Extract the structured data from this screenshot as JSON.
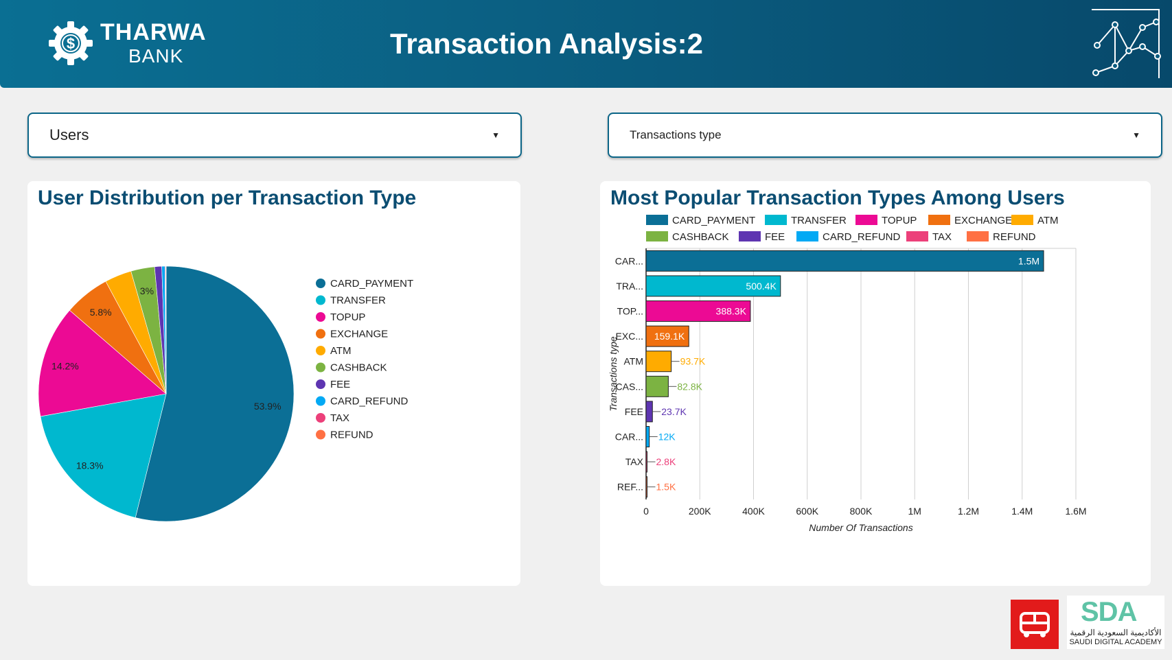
{
  "header": {
    "brand_name": "THARWA",
    "brand_sub": "BANK",
    "title": "Transaction Analysis:2"
  },
  "filters": {
    "users_label": "Users",
    "type_label": "Transactions type"
  },
  "colors": {
    "CARD_PAYMENT": "#0b6f96",
    "TRANSFER": "#00b8cf",
    "TOPUP": "#ec0a94",
    "EXCHANGE": "#f07010",
    "ATM": "#ffab00",
    "CASHBACK": "#7cb342",
    "FEE": "#5e35b1",
    "CARD_REFUND": "#03a9f4",
    "TAX": "#ec407a",
    "REFUND": "#ff7043"
  },
  "pie_chart": {
    "title": "User Distribution per Transaction Type"
  },
  "bar_chart": {
    "title": "Most Popular Transaction Types Among Users"
  },
  "chart_data": [
    {
      "type": "pie",
      "title": "User Distribution per Transaction Type",
      "categories": [
        "CARD_PAYMENT",
        "TRANSFER",
        "TOPUP",
        "EXCHANGE",
        "ATM",
        "CASHBACK",
        "FEE",
        "CARD_REFUND",
        "TAX",
        "REFUND"
      ],
      "values": [
        53.9,
        18.3,
        14.2,
        5.8,
        3.4,
        3.0,
        0.9,
        0.4,
        0.1,
        0.05
      ],
      "value_labels": [
        "53.9%",
        "18.3%",
        "14.2%",
        "5.8%",
        "",
        "3%",
        "",
        "",
        "",
        ""
      ],
      "legend": "right"
    },
    {
      "type": "bar",
      "orientation": "horizontal",
      "title": "Most Popular Transaction Types Among Users",
      "categories": [
        "CARD_PAYMENT",
        "TRANSFER",
        "TOPUP",
        "EXCHANGE",
        "ATM",
        "CASHBACK",
        "FEE",
        "CARD_REFUND",
        "TAX",
        "REFUND"
      ],
      "tick_labels": [
        "CAR...",
        "TRA...",
        "TOP...",
        "EXC...",
        "ATM",
        "CAS...",
        "FEE",
        "CAR...",
        "TAX",
        "REF..."
      ],
      "values": [
        1480000,
        500400,
        388300,
        159100,
        93700,
        82800,
        23700,
        12000,
        2800,
        1500
      ],
      "value_labels": [
        "1.5M",
        "500.4K",
        "388.3K",
        "159.1K",
        "93.7K",
        "82.8K",
        "23.7K",
        "12K",
        "2.8K",
        "1.5K"
      ],
      "xlabel": "Number Of Transactions",
      "ylabel": "Transactions type",
      "xlim": [
        0,
        1600000
      ],
      "xticks": [
        "0",
        "200K",
        "400K",
        "600K",
        "800K",
        "1M",
        "1.2M",
        "1.4M",
        "1.6M"
      ],
      "grid": true,
      "legend": "top"
    }
  ]
}
